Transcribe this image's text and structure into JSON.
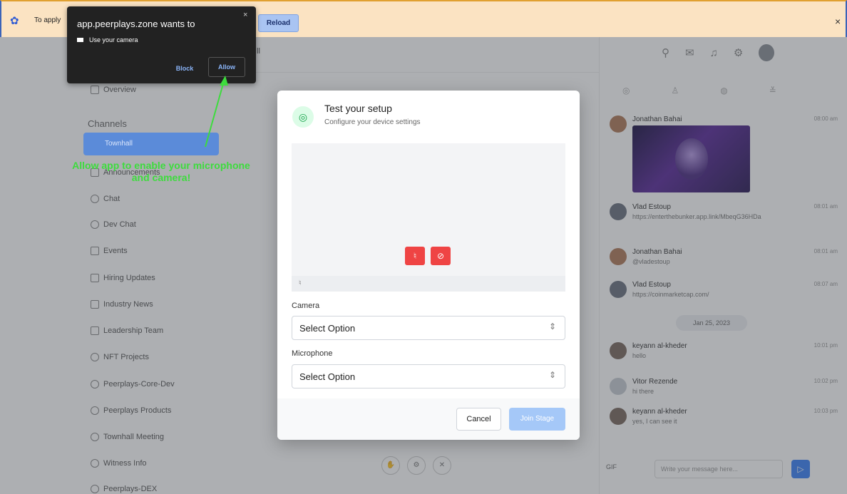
{
  "banner": {
    "apply_text": "To apply",
    "reload_label": "Reload",
    "close_label": "×"
  },
  "popup": {
    "title": "app.peerplays.zone wants to",
    "permission": "Use your camera",
    "block_label": "Block",
    "allow_label": "Allow",
    "close_label": "×"
  },
  "annotation": {
    "text": "Allow app to enable your microphone and camera!",
    "color": "#3ddc3d"
  },
  "toolbar": {
    "peek_text": "ll"
  },
  "sidebar": {
    "overview": "Overview",
    "channels_heading": "Channels",
    "active_item": "Townhall",
    "items": [
      {
        "label": "Announcements"
      },
      {
        "label": "Chat"
      },
      {
        "label": "Dev Chat"
      },
      {
        "label": "Events"
      },
      {
        "label": "Hiring Updates"
      },
      {
        "label": "Industry News"
      },
      {
        "label": "Leadership Team"
      },
      {
        "label": "NFT Projects"
      },
      {
        "label": "Peerplays-Core-Dev"
      },
      {
        "label": "Peerplays Products"
      },
      {
        "label": "Townhall Meeting"
      },
      {
        "label": "Witness Info"
      },
      {
        "label": "Peerplays-DEX"
      }
    ]
  },
  "modal": {
    "title": "Test your setup",
    "subtitle": "Configure your device settings",
    "camera_label": "Camera",
    "camera_value": "Select Option",
    "mic_label": "Microphone",
    "mic_value": "Select Option",
    "cancel_label": "Cancel",
    "join_label": "Join Stage",
    "accent": "#ef4444"
  },
  "chat": {
    "messages": [
      {
        "name": "Jonathan Bahai",
        "text": "",
        "time": "08:00 am"
      },
      {
        "name": "Vlad Estoup",
        "text": "https://enterthebunker.app.link/MbeqG36HDa",
        "time": "08:01 am"
      },
      {
        "name": "Jonathan Bahai",
        "text": "@vladestoup",
        "time": "08:01 am"
      },
      {
        "name": "Vlad Estoup",
        "text": "https://coinmarketcap.com/",
        "time": "08:07 am"
      },
      {
        "name": "keyann al-kheder",
        "text": "hello",
        "time": "10:01 pm"
      },
      {
        "name": "Vitor Rezende",
        "text": "hi there",
        "time": "10:02 pm"
      },
      {
        "name": "keyann al-kheder",
        "text": "yes, I can see it",
        "time": "10:03 pm"
      }
    ],
    "date_divider": "Jan 25, 2023",
    "input_placeholder": "Write your message here...",
    "gif_label": "GIF"
  }
}
